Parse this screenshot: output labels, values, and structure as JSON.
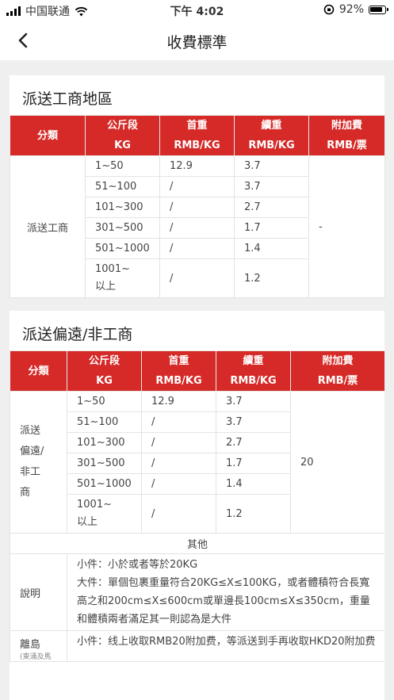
{
  "status_bar": {
    "carrier": "中国联通",
    "time": "下午 4:02",
    "battery": "92%"
  },
  "nav": {
    "title": "收費標準"
  },
  "headers": {
    "category": "分類",
    "weight_range_1": "公斤段",
    "weight_range_2": "KG",
    "first_weight_1": "首重",
    "first_weight_2": "RMB/KG",
    "continued_weight_1": "續重",
    "continued_weight_2": "RMB/KG",
    "surcharge_1": "附加費",
    "surcharge_2": "RMB/票"
  },
  "section1": {
    "title": "派送工商地區",
    "category": "派送工商",
    "surcharge": "-",
    "rows": [
      {
        "range": "1~50",
        "first": "12.9",
        "cont": "3.7"
      },
      {
        "range": "51~100",
        "first": "/",
        "cont": "3.7"
      },
      {
        "range": "101~300",
        "first": "/",
        "cont": "2.7"
      },
      {
        "range": "301~500",
        "first": "/",
        "cont": "1.7"
      },
      {
        "range": "501~1000",
        "first": "/",
        "cont": "1.4"
      },
      {
        "range": "1001~以上",
        "first": "/",
        "cont": "1.2"
      }
    ]
  },
  "section2": {
    "title": "派送偏遠/非工商",
    "category": "派送偏遠/非工商",
    "surcharge": "20",
    "rows": [
      {
        "range": "1~50",
        "first": "12.9",
        "cont": "3.7"
      },
      {
        "range": "51~100",
        "first": "/",
        "cont": "3.7"
      },
      {
        "range": "101~300",
        "first": "/",
        "cont": "2.7"
      },
      {
        "range": "301~500",
        "first": "/",
        "cont": "1.7"
      },
      {
        "range": "501~1000",
        "first": "/",
        "cont": "1.4"
      },
      {
        "range": "1001~以上",
        "first": "/",
        "cont": "1.2"
      }
    ],
    "other_header": "其他",
    "notes": [
      {
        "label": "說明",
        "lines": [
          "小件：小於或者等於20KG",
          "大件：單個包裹重量符合20KG≤X≤100KG，或者體積符合長寬高之和200cm≤X≤600cm或單邊長100cm≤X≤350cm，重量和體積兩者滿足其一則認為是大件"
        ]
      },
      {
        "label": "離島",
        "sublabel": "(東涌及馬",
        "lines": [
          "小件：线上收取RMB20附加费，等派送到手再收取HKD20附加费"
        ]
      }
    ]
  }
}
